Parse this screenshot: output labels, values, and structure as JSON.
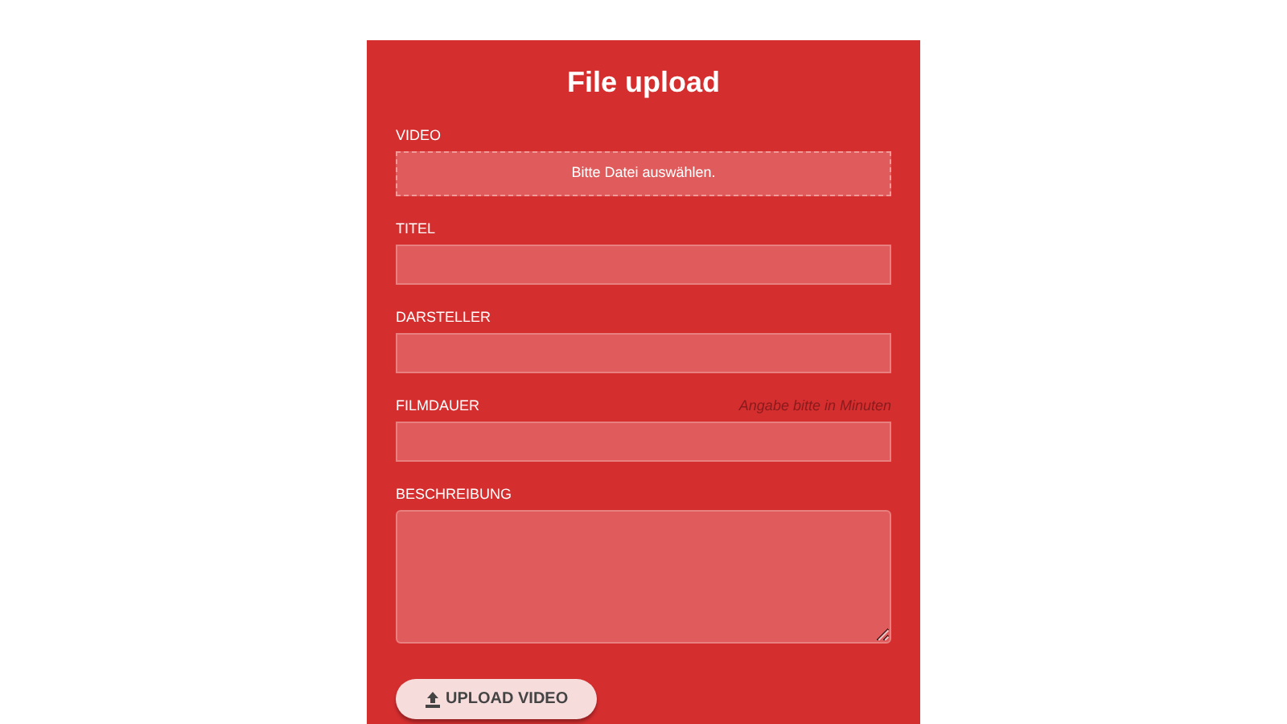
{
  "form": {
    "title": "File upload",
    "fields": [
      {
        "kind": "dropzone",
        "label": "VIDEO",
        "prompt": "Bitte Datei auswählen."
      },
      {
        "kind": "text",
        "label": "TITEL"
      },
      {
        "kind": "text",
        "label": "DARSTELLER"
      },
      {
        "kind": "text",
        "label": "FILMDAUER",
        "hint": "Angabe bitte in Minuten"
      },
      {
        "kind": "textarea",
        "label": "BESCHREIBUNG"
      }
    ],
    "submit": {
      "label": "UPLOAD VIDEO"
    }
  }
}
